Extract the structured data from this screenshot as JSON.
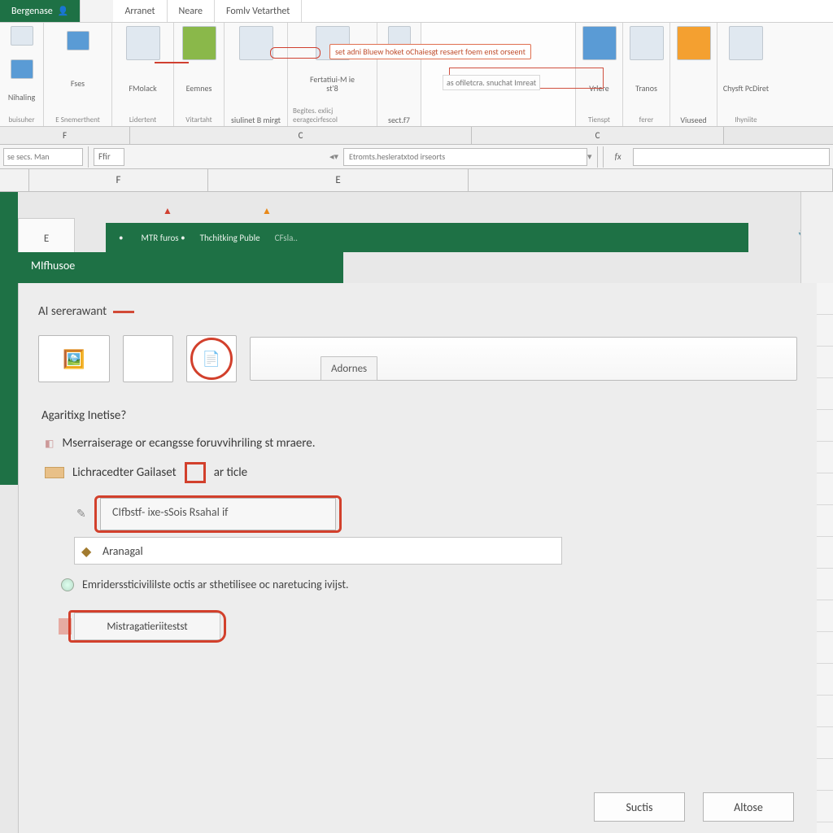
{
  "tabs": {
    "active": "Bergenase",
    "items": [
      "Arranet",
      "Neare",
      "Fomlv Vetarthet"
    ]
  },
  "ribbon": {
    "hint_top": "set adni Bluew hoket oChaiesgt resaert foem enst orseent",
    "hint_under": "as ofiletcra. snuchat Imreat",
    "groups": [
      {
        "label": "Nihaling",
        "sublabel": "buisuher",
        "icons": 2
      },
      {
        "label": "Fses",
        "sublabel": "E Snemerthent",
        "icons": 1
      },
      {
        "label": "FMolack",
        "sublabel": "Lidertent",
        "icons": 1
      },
      {
        "label": "Eemnes",
        "sublabel": "Vitartaht",
        "icons": 1
      },
      {
        "label": "siulinet B mirgt",
        "sublabel": "",
        "icons": 1
      },
      {
        "label": "Fertatiui-M ie st'8",
        "sublabel": "Begites. exlicj eeragecirfescol",
        "icons": 1
      },
      {
        "label": "sect.f7",
        "sublabel": "",
        "icons": 1
      },
      {
        "label": "Vrlere",
        "sublabel": "Tienspt",
        "icons": 1
      },
      {
        "label": "Tranos",
        "sublabel": "ferer",
        "icons": 1
      },
      {
        "label": "Viuseed",
        "sublabel": "",
        "icons": 1
      },
      {
        "label": "Chysft PcDiret",
        "sublabel": "Ihyniite",
        "icons": 1
      }
    ]
  },
  "col_heads": [
    "F",
    "C",
    "C"
  ],
  "fbar": {
    "name": "se secs. Man",
    "small": "Ffir",
    "long": "Etromts.hesleratxtod irseorts",
    "fx": "fx"
  },
  "letters": [
    "F",
    "E"
  ],
  "left_letter": "E",
  "panel": {
    "bar_items": [
      "•",
      "MTR furos •",
      "Thchitking Puble",
      "CFsla.."
    ],
    "tab_title": "MIfhusoe",
    "section1": "AI sererawant",
    "thumb_button": "Adornes",
    "question": "Agaritixg Inetise?",
    "opt1": "Mserraiserage or ecangsse foruvvihriling st mraere.",
    "opt2_a": "Lichracedter Gailaset",
    "opt2_b": "ar ticle",
    "indented_value": "CIfbstf- ixe-sSois Rsahal if",
    "plain_label": "Aranagal",
    "note": "Emriderssticivililste octis ar sthetilisee oc naretucing ivijst.",
    "chip": "Mistragatieriitestst",
    "btn_ok": "Suctis",
    "btn_cancel": "Altose"
  }
}
